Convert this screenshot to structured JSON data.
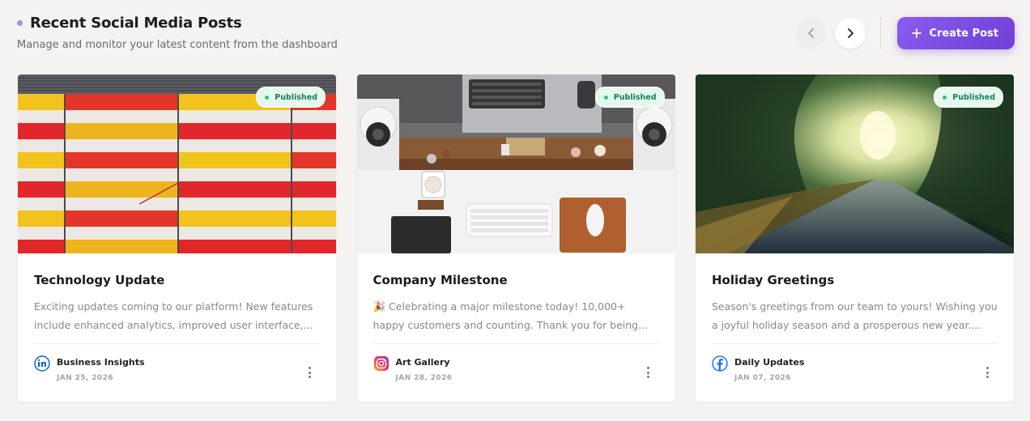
{
  "header": {
    "title": "Recent Social Media Posts",
    "subtitle": "Manage and monitor your latest content from the dashboard",
    "prev_icon": "chevron-left-icon",
    "next_icon": "chevron-right-icon",
    "create_label": "Create Post",
    "accent": "#7c4ae6"
  },
  "posts": [
    {
      "status": "Published",
      "title": "Technology Update",
      "text": "Exciting updates coming to our platform! New features include enhanced analytics, improved user interface,...",
      "account": "Business Insights",
      "platform": "linkedin",
      "date": "JAN 25, 2026",
      "image": "yellow-red-white striped building facade"
    },
    {
      "status": "Published",
      "title": "Company Milestone",
      "text": "🎉 Celebrating a major milestone today! 10,000+ happy customers and counting. Thank you for being...",
      "account": "Art Gallery",
      "platform": "instagram",
      "date": "JAN 28, 2026",
      "image": "top view desk workspace with monitor and speakers"
    },
    {
      "status": "Published",
      "title": "Holiday Greetings",
      "text": "Season's greetings from our team to yours! Wishing you a joyful holiday season and a prosperous new year....",
      "account": "Daily Updates",
      "platform": "facebook",
      "date": "JAN 07, 2026",
      "image": "sunlit tree-lined road"
    }
  ]
}
